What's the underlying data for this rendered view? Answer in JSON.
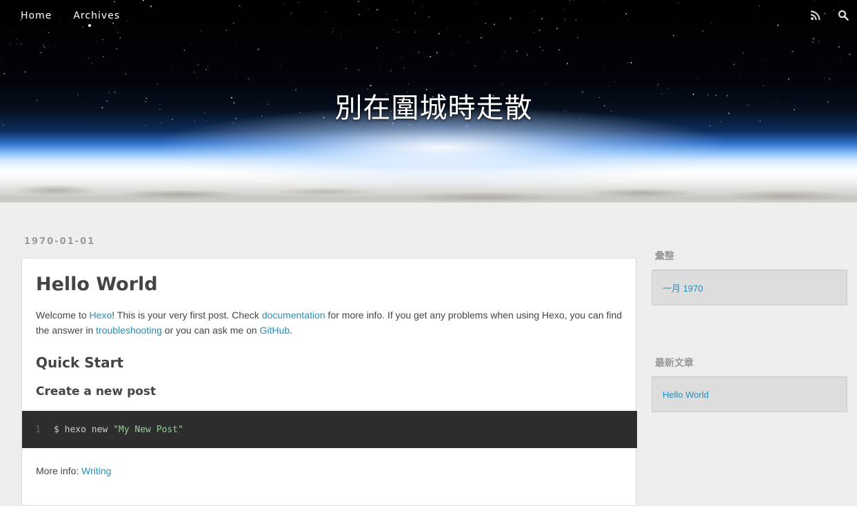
{
  "nav": {
    "links": [
      "Home",
      "Archives"
    ],
    "icons": [
      "rss-icon",
      "search-icon"
    ]
  },
  "banner": {
    "title": "別在圍城時走散"
  },
  "article": {
    "date": "1970-01-01",
    "title": "Hello World",
    "intro": {
      "t1": "Welcome to ",
      "l1": "Hexo",
      "t2": "! This is your very first post. Check ",
      "l2": "documentation",
      "t3": " for more info. If you get any problems when using Hexo, you can find the answer in ",
      "l3": "troubleshooting",
      "t4": " or you can ask me on ",
      "l4": "GitHub",
      "t5": "."
    },
    "h_quick_start": "Quick Start",
    "h_create_post": "Create a new post",
    "code": {
      "line_number": "1",
      "command": "$ hexo new ",
      "string": "\"My New Post\""
    },
    "more_info": {
      "label": "More info: ",
      "link": "Writing"
    }
  },
  "sidebar": {
    "archive": {
      "title": "彙整",
      "items": [
        "一月 1970"
      ]
    },
    "recent": {
      "title": "最新文章",
      "items": [
        "Hello World"
      ]
    }
  },
  "colors": {
    "link": "#258fb8",
    "page_bg": "#eeeeee",
    "code_bg": "#2d2d2d"
  }
}
